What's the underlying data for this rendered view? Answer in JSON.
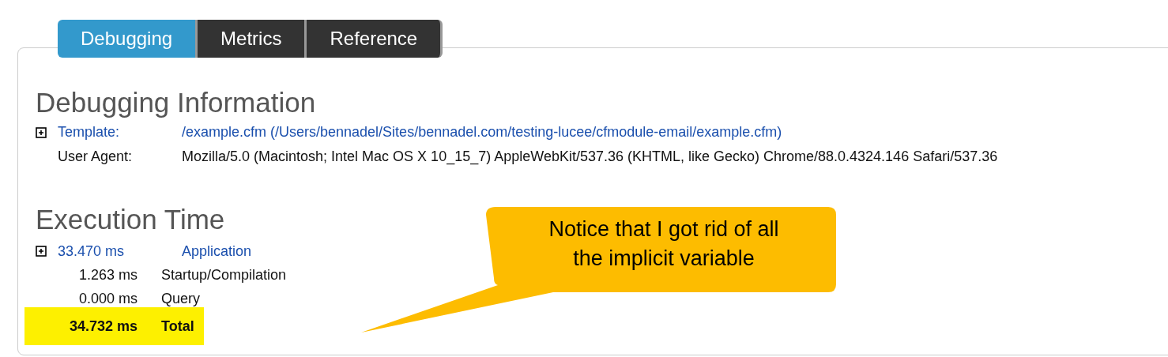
{
  "tabs": [
    {
      "label": "Debugging",
      "selected": true
    },
    {
      "label": "Metrics",
      "selected": false
    },
    {
      "label": "Reference",
      "selected": false
    }
  ],
  "debugging_information": {
    "title": "Debugging Information",
    "rows": [
      {
        "kind": "expandable",
        "label": "Template:",
        "value": "/example.cfm (/Users/bennadel/Sites/bennadel.com/testing-lucee/cfmodule-email/example.cfm)"
      },
      {
        "kind": "plain",
        "label": "User Agent:",
        "value": "Mozilla/5.0 (Macintosh; Intel Mac OS X 10_15_7) AppleWebKit/537.36 (KHTML, like Gecko) Chrome/88.0.4324.146 Safari/537.36"
      }
    ]
  },
  "execution_time": {
    "title": "Execution Time",
    "rows": [
      {
        "kind": "expandable",
        "time": "33.470 ms",
        "label": "Application"
      },
      {
        "kind": "plain",
        "time": "1.263 ms",
        "label": "Startup/Compilation"
      },
      {
        "kind": "plain",
        "time": "0.000 ms",
        "label": "Query"
      },
      {
        "kind": "total",
        "time": "34.732 ms",
        "label": "Total"
      }
    ]
  },
  "callout": {
    "text": "Notice that I got rid of all the implicit variable"
  }
}
